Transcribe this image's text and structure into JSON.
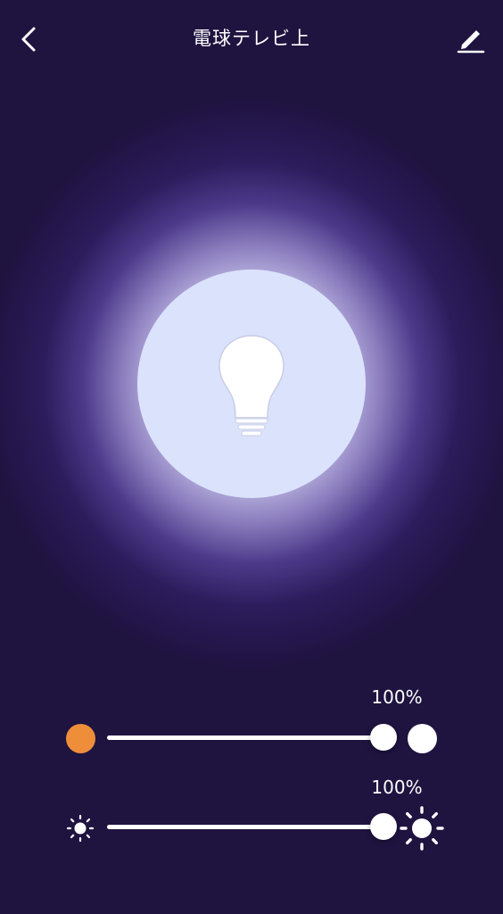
{
  "header": {
    "title": "電球テレビ上",
    "back_icon": "chevron-left-icon",
    "edit_icon": "pencil-icon"
  },
  "bulb": {
    "icon": "lightbulb-icon",
    "state": "on",
    "glow_color": "#dbe2fb"
  },
  "color_temperature": {
    "label": "100%",
    "value_percent": 100,
    "warm_color": "#ef8e3a",
    "cool_color": "#ffffff"
  },
  "brightness": {
    "label": "100%",
    "value_percent": 100,
    "low_icon": "sun-small-icon",
    "high_icon": "sun-large-icon"
  },
  "colors": {
    "background": "#1f1340",
    "accent_warm": "#ef8e3a",
    "foreground": "#ffffff"
  }
}
